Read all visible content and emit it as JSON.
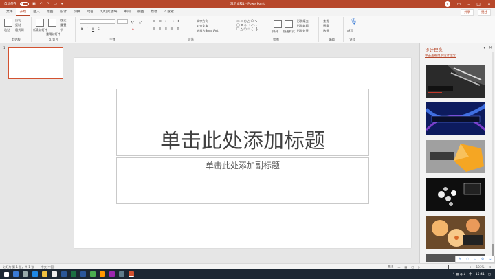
{
  "titlebar": {
    "autosave": "自动保存",
    "autosave_state": "关",
    "doc_title": "演示文稿1 - PowerPoint",
    "avatar": "Y",
    "qat_icons": [
      "save-icon",
      "undo-icon",
      "redo-icon",
      "present-icon"
    ]
  },
  "tabs": [
    "文件",
    "开始",
    "插入",
    "绘图",
    "设计",
    "切换",
    "动画",
    "幻灯片放映",
    "审阅",
    "视图",
    "帮助"
  ],
  "active_tab": "开始",
  "search": "搜索",
  "share": "共享",
  "comments": "批注",
  "ribbon": {
    "groups": [
      {
        "name": "剪贴板",
        "items": [
          "粘贴",
          "剪切",
          "复制",
          "格式刷"
        ]
      },
      {
        "name": "幻灯片",
        "items": [
          "新建幻灯片",
          "重用幻灯片",
          "版式",
          "重置",
          "节"
        ]
      },
      {
        "name": "字体",
        "items": [
          "B",
          "I",
          "U",
          "S",
          "A"
        ]
      },
      {
        "name": "段落",
        "items": [
          "文字方向",
          "对齐文本",
          "转换为SmartArt"
        ]
      },
      {
        "name": "绘图",
        "items": [
          "排列",
          "快速样式",
          "形状填充",
          "形状轮廓",
          "形状效果"
        ]
      },
      {
        "name": "编辑",
        "items": [
          "查找",
          "替换",
          "选择"
        ]
      },
      {
        "name": "语音",
        "items": [
          "听写"
        ]
      },
      {
        "name": "设计器",
        "items": [
          "设计灵感"
        ]
      }
    ]
  },
  "thumbnails": {
    "slide_number": "1"
  },
  "slide": {
    "title_placeholder": "单击此处添加标题",
    "subtitle_placeholder": "单击此处添加副标题"
  },
  "design_pane": {
    "title": "设计理念",
    "link": "单击查看更多设计理念",
    "designs": [
      {
        "bg": "#1a1a1a",
        "accent": "#c0392b"
      },
      {
        "bg": "#0d1b5e",
        "accent": "#3f51b5"
      },
      {
        "bg": "#9e9e9e",
        "accent": "#f39c12"
      },
      {
        "bg": "#111111",
        "accent": "#ffffff"
      },
      {
        "bg": "#e8a04c",
        "accent": "#2b2b2b"
      }
    ]
  },
  "statusbar": {
    "slide_info": "幻灯片 第 1 张，共 1 张",
    "language": "中文(中国)",
    "notes": "备注",
    "zoom": "103%"
  },
  "taskbar": {
    "time": "15:41",
    "lang": "中"
  }
}
